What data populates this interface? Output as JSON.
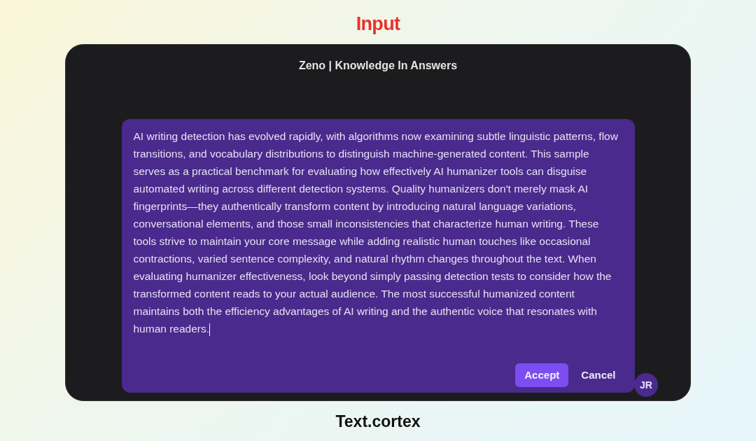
{
  "heading": "Input",
  "window": {
    "title": "Zeno | Knowledge In Answers"
  },
  "editor": {
    "text": "AI writing detection has evolved rapidly, with algorithms now examining subtle linguistic patterns, flow transitions, and vocabulary distributions to distinguish machine-generated content. This sample serves as a practical benchmark for evaluating how effectively AI humanizer tools can disguise automated writing across different detection systems. Quality humanizers don't merely mask AI fingerprints—they authentically transform content by introducing natural language variations, conversational elements, and those small inconsistencies that characterize human writing. These tools strive to maintain your core message while adding realistic human touches like occasional contractions, varied sentence complexity, and natural rhythm changes throughout the text. When evaluating humanizer effectiveness, look beyond simply passing detection tests to consider how the transformed content reads to your actual audience. The most successful humanized content maintains both the efficiency advantages of AI writing and the authentic voice that resonates with human readers.",
    "buttons": [
      {
        "kind": "primary",
        "label": "Accept"
      },
      {
        "kind": "plain",
        "label": "Cancel"
      }
    ]
  },
  "avatar": {
    "initials": "JR"
  },
  "caption": "Text.cortex"
}
